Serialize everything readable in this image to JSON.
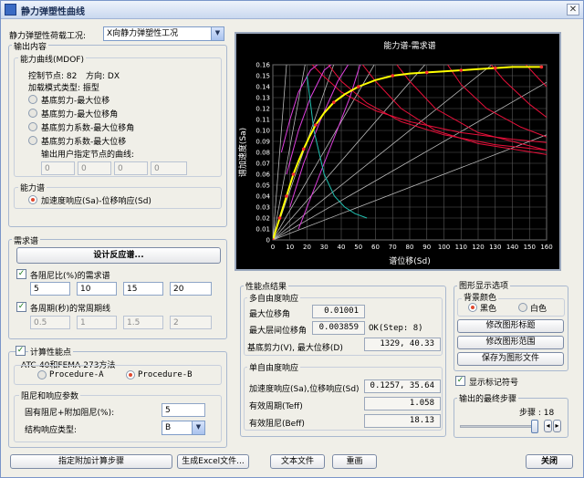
{
  "title": "静力弹塑性曲线",
  "load_case": {
    "label": "静力弹塑性荷载工况:",
    "value": "X向静力弹塑性工况"
  },
  "output": {
    "label": "输出内容",
    "capacity_curve": {
      "label": "能力曲线(MDOF)",
      "control_node": "控制节点: 82",
      "direction": "方向: DX",
      "load_pattern": "加载模式类型: 振型",
      "options": [
        "基底剪力-最大位移",
        "基底剪力-最大位移角",
        "基底剪力系数-最大位移角",
        "基底剪力系数-最大位移"
      ],
      "user_node_label": "输出用户指定节点的曲线:",
      "user_nodes": [
        "0",
        "0",
        "0",
        "0"
      ]
    },
    "capacity_spectrum": {
      "label": "能力谱",
      "option": "加速度响应(Sa)-位移响应(Sd)"
    }
  },
  "demand": {
    "label": "需求谱",
    "design_btn": "设计反应谱...",
    "damping_label": "各阻尼比(%)的需求谱",
    "damping": [
      "5",
      "10",
      "15",
      "20"
    ],
    "period_label": "各周期(秒)的常周期线",
    "periods": [
      "0.5",
      "1",
      "1.5",
      "2"
    ]
  },
  "perf": {
    "label": "计算性能点",
    "method_label": "ATC-40和FEMA-273方法",
    "proc_a": "Procedure-A",
    "proc_b": "Procedure-B",
    "damp_group": "阻尼和响应参数",
    "inherent_label": "固有阻尼+附加阻尼(%):",
    "inherent_value": "5",
    "struct_label": "结构响应类型:",
    "struct_value": "B"
  },
  "results": {
    "label": "性能点结果",
    "mdof": {
      "label": "多自由度响应",
      "max_disp_label": "最大位移角",
      "max_disp_value": "0.01001",
      "max_drift_label": "最大层间位移角",
      "max_drift_value": "0.003859",
      "step_text": "OK(Step: 8)",
      "shear_label": "基底剪力(V), 最大位移(D)",
      "shear_value": "1329,  40.33"
    },
    "sdof": {
      "label": "单自由度响应",
      "sa_sd_label": "加速度响应(Sa),位移响应(Sd)",
      "sa_sd_value": "0.1257,  35.64",
      "teff_label": "有效周期(Teff)",
      "teff_value": "1.058",
      "beff_label": "有效阻尼(Beff)",
      "beff_value": "18.13"
    }
  },
  "display": {
    "label": "图形显示选项",
    "bg_label": "背景颜色",
    "black": "黑色",
    "white": "白色",
    "btn_title": "修改图形标题",
    "btn_range": "修改图形范围",
    "btn_save": "保存为图形文件",
    "show_markers": "显示标记符号",
    "final_step_label": "输出的最终步骤",
    "step_label": "步骤 : 18"
  },
  "footer": {
    "btn_steps": "指定附加计算步骤",
    "btn_excel": "生成Excel文件...",
    "btn_text": "文本文件",
    "btn_redraw": "重画",
    "btn_close": "关闭"
  },
  "colors": {
    "capacity": "#ffff00",
    "demand": "#e8103a",
    "period": "#b8b8b8",
    "reduced": "#e040e0",
    "teal": "#20c0b0",
    "grid": "#5a5a5a"
  },
  "chart_data": {
    "type": "line",
    "title": "能力谱-需求谱",
    "xlabel": "谱位移(Sd)",
    "ylabel": "谱加速度(Sa)",
    "xlim": [
      0,
      160
    ],
    "ylim": [
      0,
      0.16
    ],
    "xticks": [
      0,
      10,
      20,
      30,
      40,
      50,
      60,
      70,
      80,
      90,
      100,
      110,
      120,
      130,
      140,
      150,
      160
    ],
    "yticks": [
      0,
      0.01,
      0.02,
      0.03,
      0.04,
      0.05,
      0.06,
      0.07,
      0.08,
      0.09,
      0.1,
      0.11,
      0.12,
      0.13,
      0.14,
      0.15,
      0.16
    ],
    "grid": true,
    "capacity": {
      "x": [
        0,
        2,
        4,
        6,
        8,
        10,
        12,
        15,
        18,
        21,
        25,
        30,
        35.64,
        42,
        50,
        60,
        70,
        80,
        90,
        100,
        110,
        120,
        130,
        140,
        157
      ],
      "y": [
        0,
        0.01,
        0.02,
        0.03,
        0.04,
        0.05,
        0.06,
        0.072,
        0.083,
        0.093,
        0.105,
        0.116,
        0.1257,
        0.133,
        0.14,
        0.146,
        0.15,
        0.152,
        0.153,
        0.154,
        0.155,
        0.156,
        0.157,
        0.158,
        0.158
      ]
    },
    "period_line_slopes": [
      0.0006,
      0.0009,
      0.00125,
      0.0018,
      0.0027,
      0.0045,
      0.0085,
      0.02
    ],
    "demand": [
      {
        "x": [
          20,
          28,
          40,
          60,
          80,
          110,
          140,
          160
        ],
        "y": [
          0.165,
          0.152,
          0.135,
          0.118,
          0.108,
          0.098,
          0.092,
          0.089
        ]
      },
      {
        "x": [
          30,
          40,
          55,
          75,
          100,
          130,
          160
        ],
        "y": [
          0.165,
          0.145,
          0.125,
          0.108,
          0.096,
          0.087,
          0.082
        ]
      },
      {
        "x": [
          50,
          60,
          75,
          95,
          120,
          160
        ],
        "y": [
          0.165,
          0.145,
          0.12,
          0.1,
          0.088,
          0.078
        ]
      },
      {
        "x": [
          70,
          80,
          95,
          120,
          160
        ],
        "y": [
          0.165,
          0.145,
          0.12,
          0.098,
          0.082
        ]
      },
      {
        "x": [
          100,
          110,
          125,
          145,
          160
        ],
        "y": [
          0.165,
          0.142,
          0.12,
          0.103,
          0.094
        ]
      },
      {
        "x": [
          125,
          135,
          150,
          160
        ],
        "y": [
          0.165,
          0.146,
          0.124,
          0.112
        ]
      },
      {
        "x": [
          145,
          155,
          160
        ],
        "y": [
          0.165,
          0.148,
          0.14
        ]
      }
    ],
    "reduced": [
      {
        "x": [
          5,
          10,
          15,
          22,
          30
        ],
        "y": [
          0.08,
          0.11,
          0.135,
          0.155,
          0.165
        ]
      },
      {
        "x": [
          8,
          15,
          22,
          30,
          38
        ],
        "y": [
          0.06,
          0.1,
          0.13,
          0.155,
          0.165
        ]
      },
      {
        "x": [
          10,
          18,
          28,
          38,
          46
        ],
        "y": [
          0.03,
          0.07,
          0.11,
          0.145,
          0.165
        ]
      },
      {
        "x": [
          15,
          25,
          35,
          45,
          52
        ],
        "y": [
          0.01,
          0.05,
          0.09,
          0.13,
          0.165
        ]
      }
    ],
    "teal": {
      "x": [
        20,
        24,
        30,
        36,
        42,
        48,
        55
      ],
      "y": [
        0.15,
        0.1,
        0.06,
        0.04,
        0.03,
        0.024,
        0.02
      ]
    }
  }
}
